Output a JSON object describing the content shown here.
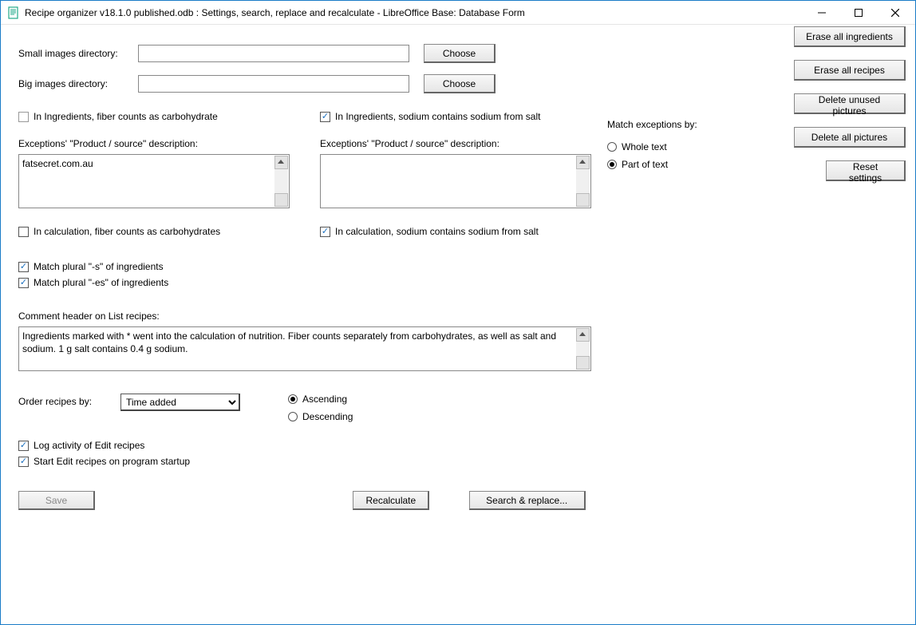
{
  "window": {
    "title": "Recipe organizer v18.1.0 published.odb : Settings, search, replace and recalculate - LibreOffice Base: Database Form"
  },
  "labels": {
    "small_images_dir": "Small images directory:",
    "big_images_dir": "Big images directory:",
    "choose": "Choose",
    "chk_fiber_ing": "In Ingredients, fiber counts as carbohydrate",
    "chk_sodium_ing": "In Ingredients, sodium contains sodium from salt",
    "exceptions_desc": "Exceptions' \"Product / source\" description:",
    "chk_fiber_calc": "In calculation, fiber counts as carbohydrates",
    "chk_sodium_calc": "In calculation, sodium contains sodium from salt",
    "chk_plural_s": "Match plural \"-s\" of ingredients",
    "chk_plural_es": "Match plural \"-es\" of ingredients",
    "comment_header": "Comment header on List recipes:",
    "order_by": "Order recipes by:",
    "asc": "Ascending",
    "desc": "Descending",
    "log_activity": "Log activity of Edit recipes",
    "start_on_startup": "Start Edit recipes on program startup",
    "match_exceptions": "Match exceptions by:",
    "whole_text": "Whole text",
    "part_of_text": "Part of text"
  },
  "values": {
    "small_images_dir": "",
    "big_images_dir": "",
    "exceptions_left": "fatsecret.com.au",
    "exceptions_right": "",
    "comment_text": "Ingredients marked with * went into the calculation of nutrition. Fiber counts separately from carbohydrates, as well as salt and sodium. 1 g salt contains 0.4 g sodium.",
    "order_by_selected": "Time added"
  },
  "buttons": {
    "save": "Save",
    "recalculate": "Recalculate",
    "search_replace": "Search & replace...",
    "erase_ingredients": "Erase all ingredients",
    "erase_recipes": "Erase all recipes",
    "delete_unused": "Delete unused pictures",
    "delete_all_pics": "Delete all pictures",
    "reset": "Reset settings"
  }
}
